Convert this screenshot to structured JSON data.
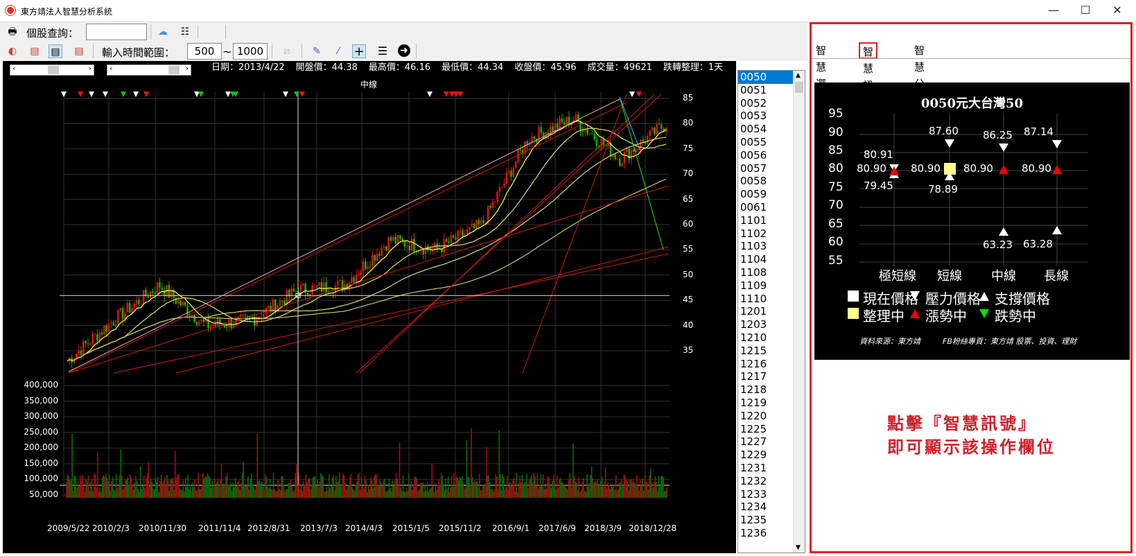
{
  "window": {
    "title": "東方靖法人智慧分析系統",
    "minimize": "—",
    "maximize": "☐",
    "close": "✕"
  },
  "toolbar1": {
    "stock_query_label": "個股查詢：",
    "stock_query_value": ""
  },
  "toolbar2": {
    "time_range_label": "輸入時間範圍：",
    "range_from": "500",
    "range_tilde": "~",
    "range_to": "1000"
  },
  "chart_info": {
    "date": "日期：2013/4/22",
    "open": "開盤價：44.38",
    "high": "最高價：46.16",
    "low": "最低價：44.34",
    "close": "收盤價：45.96",
    "volume": "成交量：49621",
    "trend": "跌轉整理：1天"
  },
  "chart_mid_label": "中線",
  "chart_data": {
    "type": "candlestick",
    "title": "",
    "price_ticks": [
      "85",
      "80",
      "75",
      "70",
      "65",
      "60",
      "55",
      "50",
      "45",
      "40",
      "35"
    ],
    "volume_ticks": [
      "400,000",
      "350,000",
      "300,000",
      "250,000",
      "200,000",
      "150,000",
      "100,000",
      "50,000"
    ],
    "x_ticks": [
      "2009/5/22",
      "2010/2/3",
      "2010/11/30",
      "2011/11/4",
      "2012/8/31",
      "2013/7/3",
      "2014/4/3",
      "2015/1/5",
      "2015/11/2",
      "2016/9/1",
      "2017/6/9",
      "2018/3/9",
      "2018/12/28"
    ],
    "crosshair": {
      "date": "2013/4/22",
      "price": 45.96
    },
    "price_path_approx": [
      {
        "x": "2009/5/22",
        "y": 33
      },
      {
        "x": "2010/2/3",
        "y": 41
      },
      {
        "x": "2010/11/30",
        "y": 48
      },
      {
        "x": "2011/11/4",
        "y": 40
      },
      {
        "x": "2012/8/31",
        "y": 41
      },
      {
        "x": "2013/7/3",
        "y": 47
      },
      {
        "x": "2014/4/3",
        "y": 48
      },
      {
        "x": "2015/1/5",
        "y": 57
      },
      {
        "x": "2015/11/2",
        "y": 55
      },
      {
        "x": "2016/9/1",
        "y": 60
      },
      {
        "x": "2017/6/9",
        "y": 77
      },
      {
        "x": "2018/3/9",
        "y": 81
      },
      {
        "x": "2018/12/28",
        "y": 73
      },
      {
        "x": "2019/6",
        "y": 80
      }
    ]
  },
  "stock_list": [
    "0050",
    "0051",
    "0052",
    "0053",
    "0054",
    "0055",
    "0056",
    "0057",
    "0058",
    "0059",
    "0061",
    "1101",
    "1102",
    "1103",
    "1104",
    "1108",
    "1109",
    "1110",
    "1201",
    "1203",
    "1210",
    "1215",
    "1216",
    "1217",
    "1218",
    "1219",
    "1220",
    "1225",
    "1227",
    "1229",
    "1231",
    "1232",
    "1233",
    "1234",
    "1235",
    "1236"
  ],
  "tabs": [
    "智慧選股",
    "智慧訊號",
    "智慧分析"
  ],
  "signal": {
    "title": "0050元大台灣50",
    "y_ticks": [
      "95",
      "90",
      "85",
      "80",
      "75",
      "70",
      "65",
      "60",
      "55"
    ],
    "columns": [
      "極短線",
      "短線",
      "中線",
      "長線"
    ],
    "values": {
      "vshort_resist": "80.91",
      "vshort_price": "80.90",
      "vshort_support": "79.45",
      "short_resist": "87.60",
      "short_price": "80.90",
      "short_support": "78.89",
      "mid_resist": "86.25",
      "mid_price": "80.90",
      "mid_support": "63.23",
      "long_resist": "87.14",
      "long_price": "80.90",
      "long_support": "63.28"
    },
    "legend": [
      "現在價格",
      "壓力價格",
      "支撐價格",
      "整理中",
      "漲勢中",
      "跌勢中"
    ],
    "source": "資料來源：東方靖",
    "fb": "FB粉絲專頁：東方靖 股票、投資、理財"
  },
  "note": {
    "line1": "點擊『智慧訊號』",
    "line2": "即可顯示該操作欄位"
  },
  "colors": {
    "accent_red": "#e0201e",
    "up": "#ff0000",
    "down": "#00cc00",
    "consolidation": "#ffff88"
  }
}
